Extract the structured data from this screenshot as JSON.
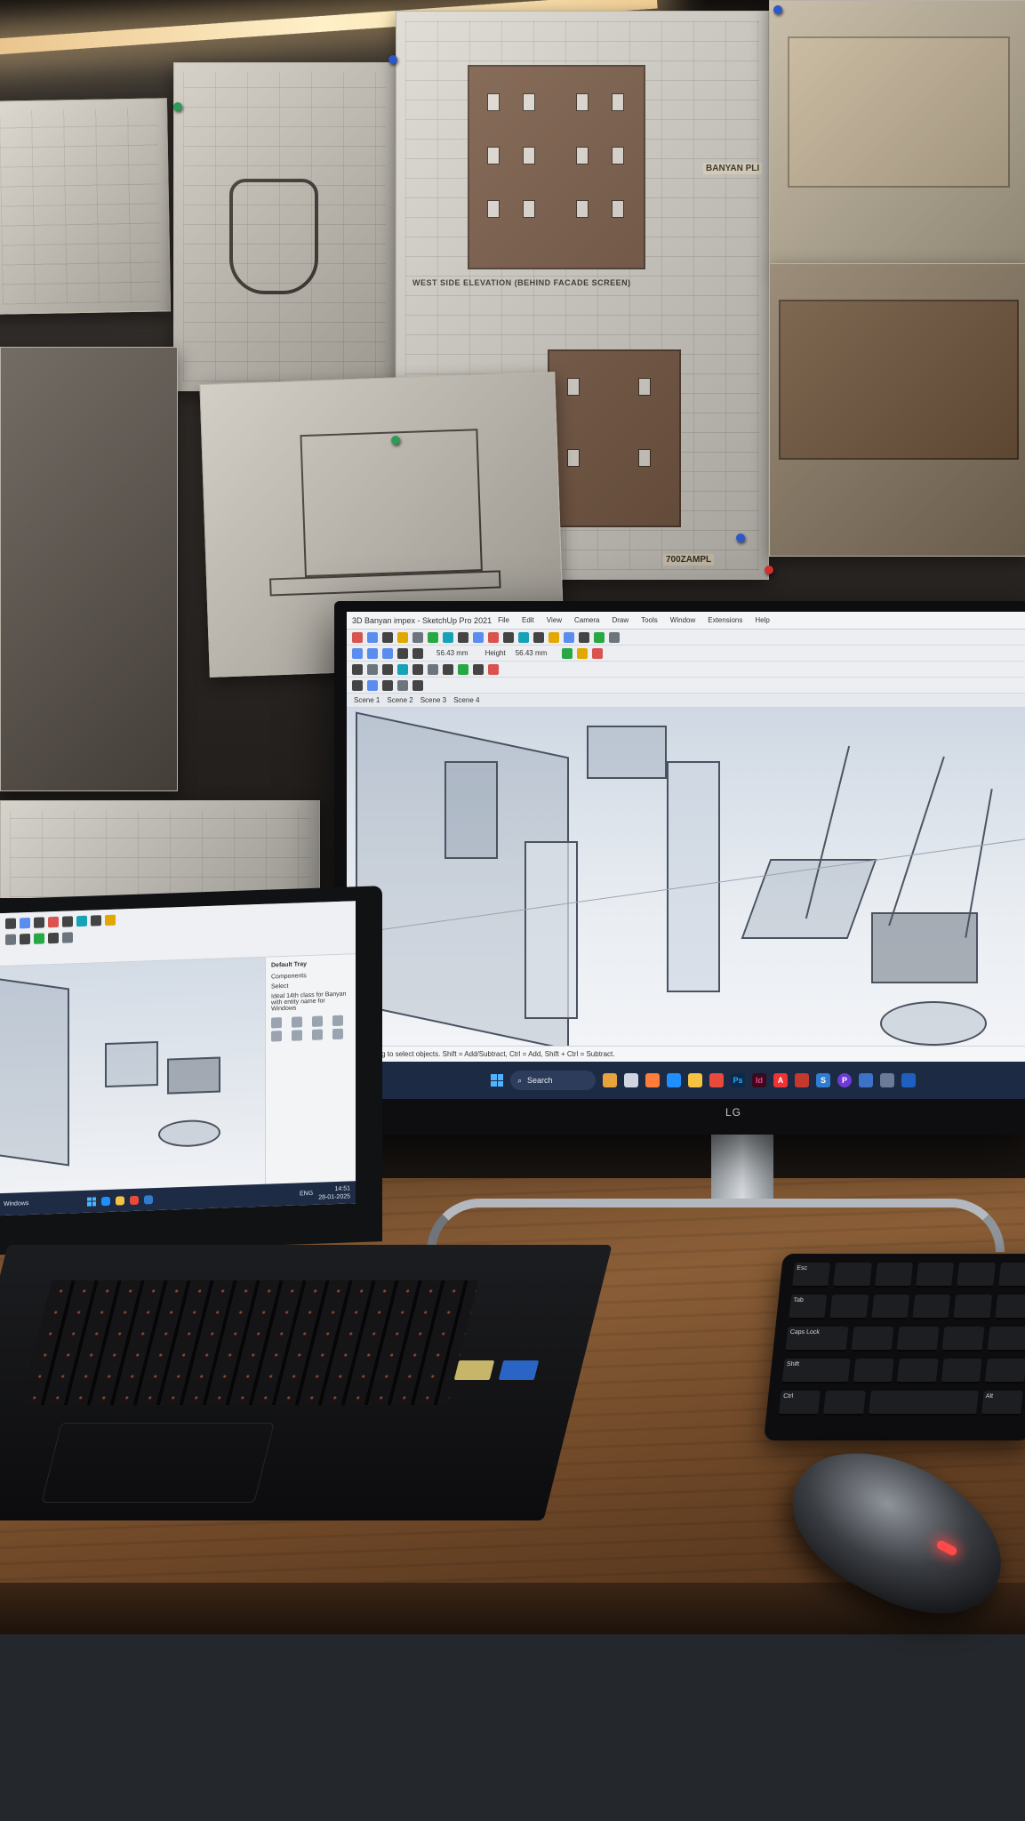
{
  "wall": {
    "drawing_c": {
      "caption": "WEST SIDE ELEVATION (BEHIND FACADE SCREEN)",
      "stamp": "BANYAN PLI",
      "tag": "700ZAMPL"
    }
  },
  "monitor": {
    "brand": "LG",
    "window_title": "3D Banyan impex - SketchUp Pro 2021",
    "menu": [
      "File",
      "Edit",
      "View",
      "Camera",
      "Draw",
      "Tools",
      "Window",
      "Extensions",
      "Help"
    ],
    "measure_fields": [
      "56.43 mm",
      "Height",
      "56.43 mm"
    ],
    "scenes": [
      "Scene 1",
      "Scene 2",
      "Scene 3",
      "Scene 4"
    ],
    "status_text": "ck or drag to select objects. Shift = Add/Subtract, Ctrl = Add, Shift + Ctrl = Subtract.",
    "taskbar": {
      "search_label": "Search",
      "app_icons": [
        "Ps",
        "Id",
        "A",
        "S",
        "P"
      ]
    }
  },
  "laptop": {
    "panel": {
      "title": "Default Tray",
      "section_components": "Components",
      "section_select": "Select",
      "desc": "Ideal 14th class for Banyan with entity name for Windows"
    },
    "taskbar_left": "Windows",
    "taskbar_time": "14:51",
    "taskbar_date": "28-01-2025",
    "taskbar_lang": "ENG"
  },
  "keyboard": {
    "keys": [
      "Esc",
      "Tab",
      "Caps Lock",
      "Shift",
      "Ctrl",
      "Alt"
    ]
  },
  "colors": {
    "wood": "#8a5e37",
    "taskbar": "#1c2a44",
    "sketchup_bg": "#dfe6ee",
    "glow": "#fff0c8",
    "keyboard_backlight": "#ff6e46"
  }
}
